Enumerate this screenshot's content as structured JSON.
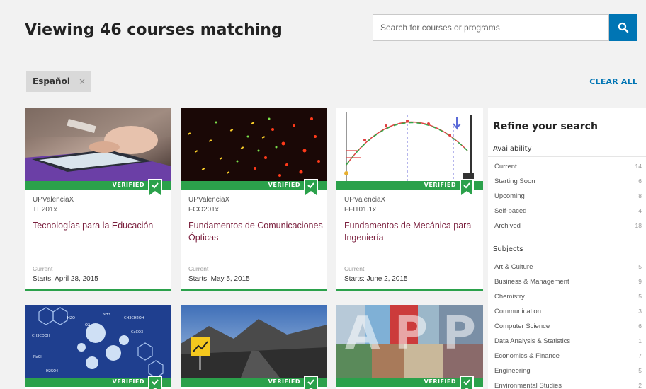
{
  "header": {
    "title": "Viewing 46 courses matching",
    "search_placeholder": "Search for courses or programs"
  },
  "filters": {
    "active": [
      {
        "label": "Español",
        "remove": "×"
      }
    ],
    "clear_all": "CLEAR ALL"
  },
  "verified_label": "VERIFIED",
  "courses": [
    {
      "org": "UPValenciaX",
      "code": "TE201x",
      "title": "Tecnologías para la Educación",
      "status": "Current",
      "starts": "Starts: April 28, 2015"
    },
    {
      "org": "UPValenciaX",
      "code": "FCO201x",
      "title": "Fundamentos de Comunicaciones Ópticas",
      "status": "Current",
      "starts": "Starts: May 5, 2015"
    },
    {
      "org": "UPValenciaX",
      "code": "FFI101.1x",
      "title": "Fundamentos de Mecánica para Ingeniería",
      "status": "Current",
      "starts": "Starts: June 2, 2015"
    }
  ],
  "sidebar": {
    "title": "Refine your search",
    "availability": {
      "heading": "Availability",
      "items": [
        {
          "label": "Current",
          "count": "14"
        },
        {
          "label": "Starting Soon",
          "count": "6"
        },
        {
          "label": "Upcoming",
          "count": "8"
        },
        {
          "label": "Self-paced",
          "count": "4"
        },
        {
          "label": "Archived",
          "count": "18"
        }
      ]
    },
    "subjects": {
      "heading": "Subjects",
      "items": [
        {
          "label": "Art & Culture",
          "count": "5"
        },
        {
          "label": "Business & Management",
          "count": "9"
        },
        {
          "label": "Chemistry",
          "count": "5"
        },
        {
          "label": "Communication",
          "count": "3"
        },
        {
          "label": "Computer Science",
          "count": "6"
        },
        {
          "label": "Data Analysis & Statistics",
          "count": "1"
        },
        {
          "label": "Economics & Finance",
          "count": "7"
        },
        {
          "label": "Engineering",
          "count": "5"
        },
        {
          "label": "Environmental Studies",
          "count": "2"
        }
      ]
    }
  },
  "colors": {
    "accent": "#0075b4",
    "verified_green": "#2ba14b",
    "course_title": "#7a1f3d"
  }
}
